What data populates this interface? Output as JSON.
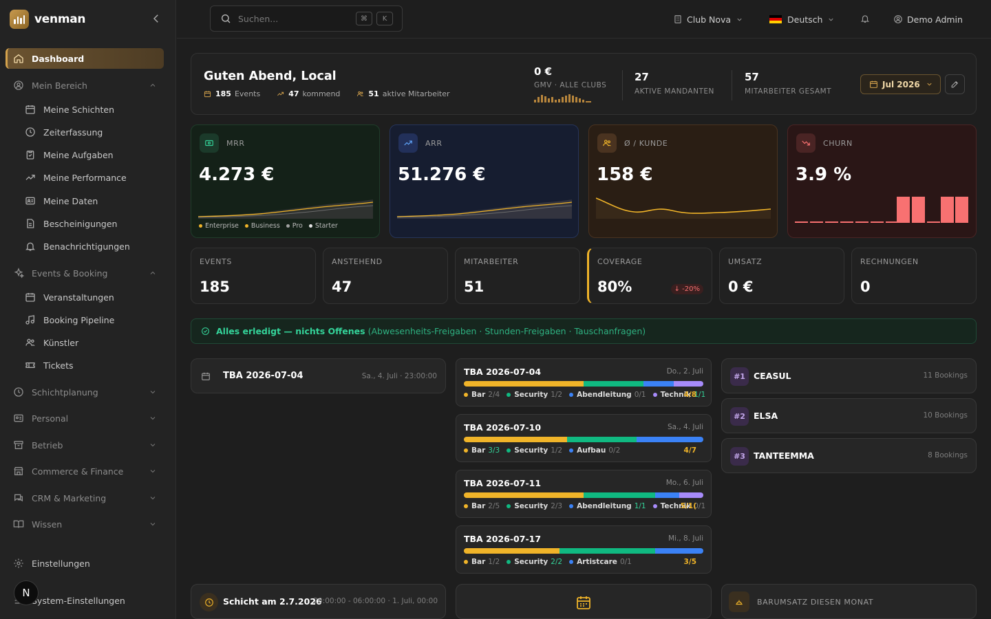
{
  "brand": {
    "name": "venman"
  },
  "sidebar": {
    "dashboard": "Dashboard",
    "mein_bereich": "Mein Bereich",
    "mein_items": [
      "Meine Schichten",
      "Zeiterfassung",
      "Meine Aufgaben",
      "Meine Performance",
      "Meine Daten",
      "Bescheinigungen",
      "Benachrichtigungen"
    ],
    "events_booking": "Events & Booking",
    "events_items": [
      "Veranstaltungen",
      "Booking Pipeline",
      "Künstler",
      "Tickets"
    ],
    "groups": [
      "Schichtplanung",
      "Personal",
      "Betrieb",
      "Commerce & Finance",
      "CRM & Marketing",
      "Wissen"
    ],
    "einstellungen": "Einstellungen",
    "system": "System-Einstellungen",
    "avatar_letter": "N"
  },
  "topbar": {
    "search_placeholder": "Suchen...",
    "kbd1": "⌘",
    "kbd2": "K",
    "club": "Club Nova",
    "language": "Deutsch",
    "user": "Demo Admin"
  },
  "greeting": {
    "title": "Guten Abend, Local",
    "events_n": "185",
    "events_l": "Events",
    "kommend_n": "47",
    "kommend_l": "kommend",
    "mitarbeiter_n": "51",
    "mitarbeiter_l": "aktive Mitarbeiter",
    "gmv_v": "0 €",
    "gmv_l": "GMV · ALLE CLUBS",
    "mandanten_v": "27",
    "mandanten_l": "AKTIVE MANDANTEN",
    "mitgesamt_v": "57",
    "mitgesamt_l": "MITARBEITER GESAMT",
    "month": "Jul 2026"
  },
  "kpis": {
    "mrr": {
      "label": "MRR",
      "value": "4.273 €",
      "legend": [
        "Enterprise",
        "Business",
        "Pro",
        "Starter"
      ]
    },
    "arr": {
      "label": "ARR",
      "value": "51.276 €"
    },
    "kunde": {
      "label": "Ø / KUNDE",
      "value": "158 €"
    },
    "churn": {
      "label": "CHURN",
      "value": "3.9 %"
    }
  },
  "stats": [
    {
      "label": "EVENTS",
      "value": "185"
    },
    {
      "label": "ANSTEHEND",
      "value": "47"
    },
    {
      "label": "MITARBEITER",
      "value": "51"
    },
    {
      "label": "COVERAGE",
      "value": "80%",
      "delta": "↓ -20%"
    },
    {
      "label": "UMSATZ",
      "value": "0 €"
    },
    {
      "label": "RECHNUNGEN",
      "value": "0"
    }
  ],
  "banner": {
    "main": "Alles erledigt — nichts Offenes",
    "extra": "(Abwesenheits-Freigaben · Stunden-Freigaben · Tauschanfragen)"
  },
  "upcoming": {
    "title": "TBA 2026-07-04",
    "date": "Sa., 4. Juli · 23:00:00"
  },
  "shift": {
    "title": "Schicht am 2.7.2026",
    "date": "20:00:00 - 06:00:00 · 1. Juli, 00:00"
  },
  "events": [
    {
      "title": "TBA 2026-07-04",
      "date": "Do., 2. Juli",
      "total": "4/8",
      "roles": [
        {
          "name": "Bar",
          "count": "2/4",
          "ok": false
        },
        {
          "name": "Security",
          "count": "1/2",
          "ok": false
        },
        {
          "name": "Abendleitung",
          "count": "0/1",
          "ok": false
        },
        {
          "name": "Technik",
          "count": "1/1",
          "ok": true
        }
      ]
    },
    {
      "title": "TBA 2026-07-10",
      "date": "Sa., 4. Juli",
      "total": "4/7",
      "roles": [
        {
          "name": "Bar",
          "count": "3/3",
          "ok": true
        },
        {
          "name": "Security",
          "count": "1/2",
          "ok": false
        },
        {
          "name": "Aufbau",
          "count": "0/2",
          "ok": false
        }
      ]
    },
    {
      "title": "TBA 2026-07-11",
      "date": "Mo., 6. Juli",
      "total": "5/1(",
      "roles": [
        {
          "name": "Bar",
          "count": "2/5",
          "ok": false
        },
        {
          "name": "Security",
          "count": "2/3",
          "ok": false
        },
        {
          "name": "Abendleitung",
          "count": "1/1",
          "ok": true
        },
        {
          "name": "Technik",
          "count": "0/1",
          "ok": false
        }
      ]
    },
    {
      "title": "TBA 2026-07-17",
      "date": "Mi., 8. Juli",
      "total": "3/5",
      "roles": [
        {
          "name": "Bar",
          "count": "1/2",
          "ok": false
        },
        {
          "name": "Security",
          "count": "2/2",
          "ok": true
        },
        {
          "name": "Artistcare",
          "count": "0/1",
          "ok": false
        }
      ]
    }
  ],
  "ranking": [
    {
      "rank": "#1",
      "name": "CEASUL",
      "count": "11 Bookings"
    },
    {
      "rank": "#2",
      "name": "ELSA",
      "count": "10 Bookings"
    },
    {
      "rank": "#3",
      "name": "TANTEEMMA",
      "count": "8 Bookings"
    }
  ],
  "barumsatz": {
    "label": "BARUMSATZ DIESEN MONAT"
  },
  "colors": {
    "accent": "#d4a24c",
    "bar": "#f0b429",
    "security": "#10b981",
    "lead": "#3b82f6",
    "tech": "#a78bfa",
    "churn": "#f87171"
  }
}
